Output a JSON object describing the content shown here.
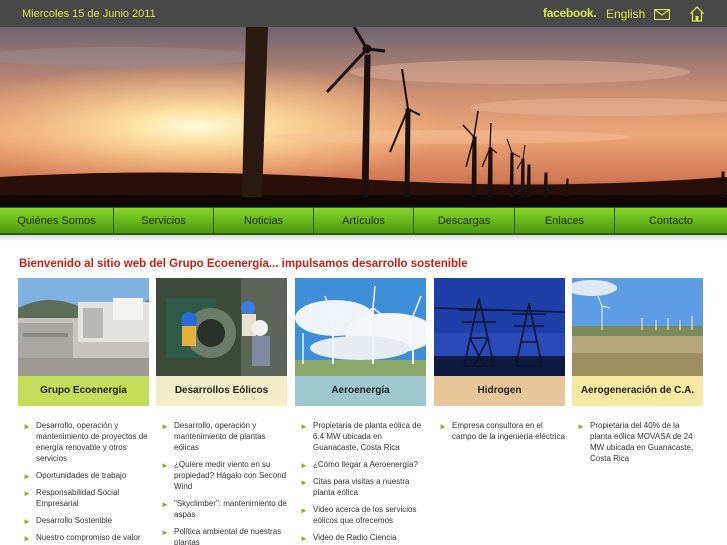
{
  "topbar": {
    "date": "Miercoles 15 de Junio 2011",
    "facebook": "facebook.",
    "language": "English",
    "mail_icon": "mail-icon",
    "home_icon": "home-icon"
  },
  "nav": {
    "items": [
      "Quiénes Somos",
      "Servicios",
      "Noticias",
      "Artículos",
      "Descargas",
      "Enlaces",
      "Contacto"
    ]
  },
  "welcome": "Bienvenido al sitio web del Grupo Ecoenergía... impulsamos desarrollo sostenible",
  "cards": [
    {
      "title": "Grupo Ecoenergía",
      "label_color": "#c6dd5c",
      "items": [
        "Desarrollo, operación y mantenimiento de proyectos de energía renovable y otros servicios",
        "Oportunidades de trabajo",
        "Responsabilidad Social Empresarial",
        "Desarrollo Sostenible",
        "Nuestro compromiso de valor"
      ]
    },
    {
      "title": "Desarrollos Eólicos",
      "label_color": "#f1eec8",
      "items": [
        "Desarrollo, operación y mantenimiento de plantas eólicas",
        "¿Quiere medir viento en su propiedad? Hágalo con Second Wind",
        "\"Skyclimber\": mantenimiento de aspas",
        "Política ambiental de nuestras plantas"
      ]
    },
    {
      "title": "Aeroenergía",
      "label_color": "#9cc8ce",
      "items": [
        "Propietaria de planta eólica de 6.4 MW ubicada en Guanacaste, Costa Rica",
        "¿Cómo llegar a Aeroenergía?",
        "Citas para visitas a nuestra planta eólica",
        "Video acerca de los servicios eólicos que ofrecemos",
        "Video de Radio Ciencia"
      ]
    },
    {
      "title": "Hidrogen",
      "label_color": "#e7c699",
      "items": [
        "Empresa consultora en el campo de la ingeniería eléctrica"
      ]
    },
    {
      "title": "Aerogeneración de C.A.",
      "label_color": "#f7e9a2",
      "items": [
        "Propietaria del 40% de la planta eólica MOVASA de 24 MW ubicada en Guanacaste, Costa Rica"
      ]
    }
  ]
}
